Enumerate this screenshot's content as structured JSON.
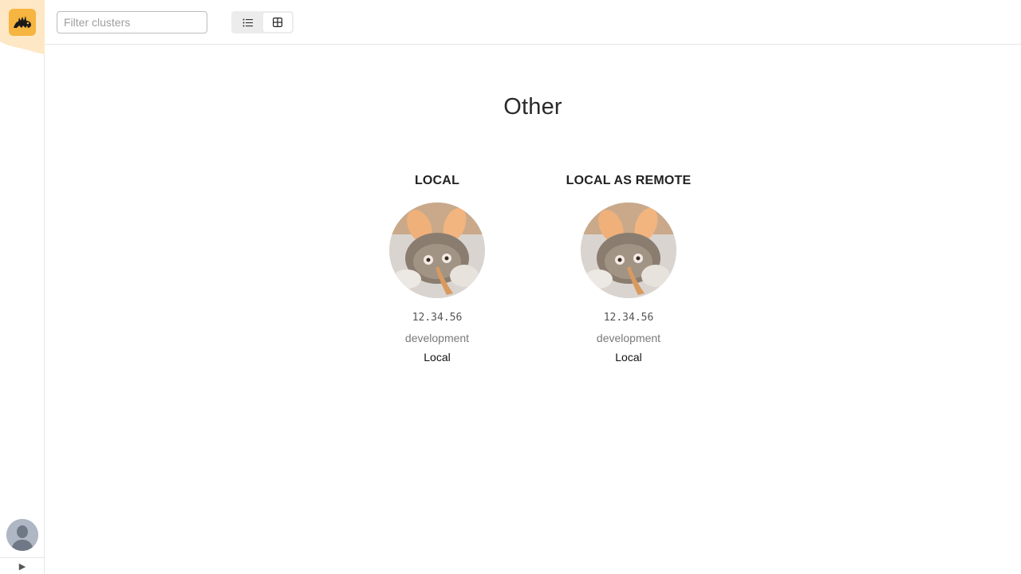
{
  "app": {
    "accent_color": "#f6b440"
  },
  "sidebar": {
    "logo_icon": "dragon-logo-icon",
    "user_icon": "user-avatar-icon",
    "expand_symbol": "▶"
  },
  "toolbar": {
    "filter": {
      "placeholder": "Filter clusters",
      "value": ""
    },
    "view_modes": [
      {
        "name": "list",
        "icon": "list-icon",
        "active": false
      },
      {
        "name": "grid",
        "icon": "grid-icon",
        "active": true
      }
    ]
  },
  "groups": [
    {
      "title": "Other",
      "clusters": [
        {
          "name": "LOCAL",
          "version": "12.34.56",
          "environment": "development",
          "type": "Local",
          "avatar_icon": "cluster-avatar-image"
        },
        {
          "name": "LOCAL AS REMOTE",
          "version": "12.34.56",
          "environment": "development",
          "type": "Local",
          "avatar_icon": "cluster-avatar-image"
        }
      ]
    }
  ]
}
